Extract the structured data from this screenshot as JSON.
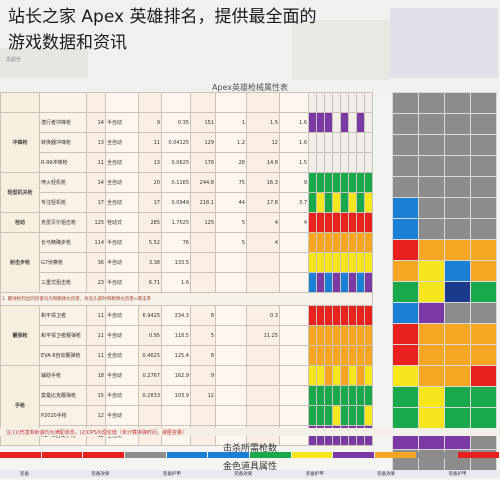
{
  "overlay": {
    "line1": "站长之家 Apex 英雄排名，提供最全面的",
    "line2": "游戏数据和资讯"
  },
  "sheet": {
    "title": "Apex英雄枪械属性表",
    "top_left_label": "文武分",
    "categories": [
      "冲锋枪",
      "轻型机关枪",
      "栓动",
      "射击步枪",
      "霰弹枪",
      "手枪"
    ],
    "rows": [
      {
        "cat": "",
        "name": "",
        "a": "",
        "b": "",
        "c": "",
        "d": "",
        "e": "",
        "f": "",
        "g": "",
        "h": ""
      },
      {
        "cat": "冲锋枪",
        "name": "潜行者冲锋枪",
        "a": "14",
        "b": "半自动",
        "c": "9",
        "d": "0.35",
        "e": "151",
        "f": "1",
        "g": "1.5",
        "h": "1.6"
      },
      {
        "cat": "",
        "name": "转换器冲锋枪",
        "a": "13",
        "b": "全自动",
        "c": "11",
        "d": "0.04125",
        "e": "129",
        "f": "1.2",
        "g": "12",
        "h": "1.6"
      },
      {
        "cat": "",
        "name": "R-99冲锋枪",
        "a": "11",
        "b": "全自动",
        "c": "13",
        "d": "0.0625",
        "e": "176",
        "f": "28",
        "g": "14.8",
        "h": "1.5"
      },
      {
        "cat": "轻型机关枪",
        "name": "喷火轻机枪",
        "a": "14",
        "b": "全自动",
        "c": "20",
        "d": "0.1165",
        "e": "244.8",
        "f": "75",
        "g": "16.3",
        "h": "9"
      },
      {
        "cat": "",
        "name": "专注轻机枪",
        "a": "17",
        "b": "全自动",
        "c": "17",
        "d": "0.0949",
        "e": "218.1",
        "f": "44",
        "g": "17.8",
        "h": "3.7"
      },
      {
        "cat": "栓动",
        "name": "克雷贝尔狙击枪",
        "a": "125",
        "b": "栓动式",
        "c": "285",
        "d": "1.7025",
        "e": "125",
        "f": "5",
        "g": "4",
        "h": "4"
      },
      {
        "cat": "射击步枪",
        "name": "长弓精确步枪",
        "a": "114",
        "b": "半自动",
        "c": "5.52",
        "d": "76",
        "f": "5",
        "g": "4",
        "h": ""
      },
      {
        "cat": "",
        "name": "G7侦察枪",
        "a": "36",
        "b": "半自动",
        "c": "3.38",
        "d": "133.5",
        "f": "",
        "g": "",
        "h": ""
      },
      {
        "cat": "",
        "name": "三重式狙击枪",
        "a": "23",
        "b": "半自动",
        "c": "6.71",
        "d": "1.6",
        "f": "",
        "g": "",
        "h": ""
      },
      {
        "cat": "霰弹枪",
        "name": "和平捍卫者",
        "a": "11",
        "b": "半自动",
        "c": "6.9425",
        "d": "234.3",
        "e": "8",
        "f": "",
        "g": "0.3",
        "h": ""
      },
      {
        "cat": "",
        "name": "和平捍卫者霰弹枪",
        "a": "11",
        "b": "半自动",
        "c": "0.95",
        "d": "118.5",
        "e": "5",
        "f": "",
        "g": "11.25",
        "h": ""
      },
      {
        "cat": "",
        "name": "EVA-8自动霰弹枪",
        "a": "11",
        "b": "全自动",
        "c": "0.4625",
        "d": "125.4",
        "e": "8",
        "f": "",
        "g": "",
        "h": ""
      },
      {
        "cat": "手枪",
        "name": "辅助手枪",
        "a": "18",
        "b": "半自动",
        "c": "0.2767",
        "d": "162.9",
        "e": "9",
        "f": "",
        "g": "",
        "h": ""
      },
      {
        "cat": "",
        "name": "莫桑比克霰弹枪",
        "a": "15",
        "b": "半自动",
        "c": "0.2833",
        "d": "103.9",
        "e": "12",
        "f": "",
        "g": "",
        "h": ""
      },
      {
        "cat": "",
        "name": "P2020手枪",
        "a": "12",
        "b": "半自动",
        "c": "",
        "d": "",
        "e": "",
        "f": "",
        "g": "",
        "h": ""
      },
      {
        "cat": "",
        "name": "RE-45自动手枪",
        "a": "12",
        "b": "全自动",
        "c": "",
        "d": "",
        "e": "",
        "f": "",
        "g": "",
        "h": ""
      }
    ],
    "note_row": "1. 霰弹枪列出的伤害均为每颗弹丸伤害，射击头部时每颗弹丸伤害×暴击率",
    "bottom_note": "注:(1)伤害和射速均为满配状态，(2)DPS为理论值（未计算换弹时间，弹匣容量）",
    "section1": "击杀所需枪数",
    "section2": "金色道具属性",
    "sub_cols": [
      "装备",
      "装备效果",
      "装备护甲",
      "装备效果",
      "装备护甲",
      "装备效果",
      "装备护甲"
    ]
  },
  "colors": {
    "red": "#e8201e",
    "orange": "#f5a623",
    "yellow": "#f7e61c",
    "green": "#19a84c",
    "blue": "#1b7fd6",
    "purple": "#7b3aa3",
    "gray": "#8c8c8c",
    "darkblue": "#1c3a8c"
  },
  "heat_rows": [
    [
      "gray",
      "gray",
      "gray",
      "gray"
    ],
    [
      "gray",
      "gray",
      "gray",
      "gray"
    ],
    [
      "gray",
      "gray",
      "gray",
      "gray"
    ],
    [
      "gray",
      "gray",
      "gray",
      "gray"
    ],
    [
      "gray",
      "gray",
      "gray",
      "gray"
    ],
    [
      "blue",
      "gray",
      "gray",
      "gray"
    ],
    [
      "blue",
      "gray",
      "gray",
      "gray"
    ],
    [
      "red",
      "orange",
      "orange",
      "orange"
    ],
    [
      "orange",
      "yellow",
      "blue",
      "orange"
    ],
    [
      "green",
      "yellow",
      "darkblue",
      "green"
    ],
    [
      "blue",
      "purple",
      "gray",
      "gray"
    ],
    [
      "red",
      "orange",
      "orange",
      "orange"
    ],
    [
      "red",
      "orange",
      "orange",
      "orange"
    ],
    [
      "yellow",
      "orange",
      "orange",
      "red"
    ],
    [
      "green",
      "yellow",
      "green",
      "green"
    ],
    [
      "green",
      "yellow",
      "green",
      "green"
    ],
    [
      "purple",
      "purple",
      "purple",
      "gray"
    ],
    [
      "gray",
      "gray",
      "gray",
      "gray"
    ]
  ],
  "mid_stripes": [
    [
      "",
      "",
      "",
      "",
      "",
      "",
      "",
      ""
    ],
    [
      "purple",
      "purple",
      "purple",
      "",
      "purple",
      "",
      "purple",
      ""
    ],
    [
      "",
      "",
      "",
      "",
      "",
      "",
      "",
      ""
    ],
    [
      "",
      "",
      "",
      "",
      "",
      "",
      "",
      ""
    ],
    [
      "green",
      "green",
      "green",
      "green",
      "green",
      "green",
      "green",
      "green"
    ],
    [
      "green",
      "yellow",
      "green",
      "yellow",
      "green",
      "yellow",
      "green",
      "yellow"
    ],
    [
      "red",
      "red",
      "red",
      "red",
      "red",
      "red",
      "red",
      "red"
    ],
    [
      "orange",
      "orange",
      "orange",
      "orange",
      "orange",
      "orange",
      "orange",
      "orange"
    ],
    [
      "yellow",
      "yellow",
      "yellow",
      "yellow",
      "yellow",
      "yellow",
      "yellow",
      "yellow"
    ],
    [
      "blue",
      "purple",
      "blue",
      "purple",
      "blue",
      "purple",
      "blue",
      "purple"
    ],
    [
      "red",
      "red",
      "red",
      "red",
      "red",
      "red",
      "red",
      "red"
    ],
    [
      "orange",
      "orange",
      "orange",
      "orange",
      "orange",
      "orange",
      "orange",
      "orange"
    ],
    [
      "orange",
      "orange",
      "orange",
      "orange",
      "orange",
      "orange",
      "orange",
      "orange"
    ],
    [
      "yellow",
      "yellow",
      "orange",
      "yellow",
      "orange",
      "yellow",
      "orange",
      "yellow"
    ],
    [
      "green",
      "green",
      "green",
      "green",
      "green",
      "green",
      "green",
      "green"
    ],
    [
      "green",
      "green",
      "green",
      "yellow",
      "green",
      "green",
      "green",
      "yellow"
    ],
    [
      "purple",
      "purple",
      "purple",
      "purple",
      "purple",
      "purple",
      "purple",
      "purple"
    ],
    [
      "",
      "",
      "",
      "",
      "",
      "",
      "",
      ""
    ]
  ],
  "bottom_stripe": [
    "red",
    "red",
    "red",
    "gray",
    "blue",
    "blue",
    "green",
    "yellow",
    "purple",
    "orange",
    "gray",
    "red"
  ]
}
